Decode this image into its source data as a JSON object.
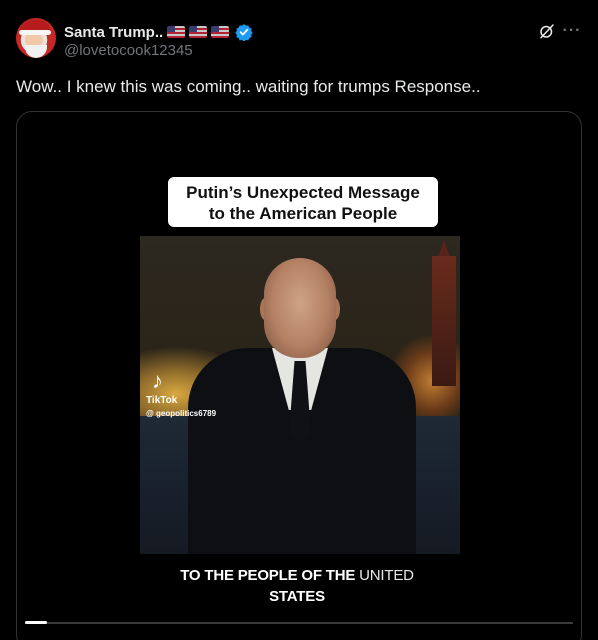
{
  "tweet": {
    "display_name": "Santa Trump..",
    "flags": [
      "us-flag",
      "us-flag",
      "us-flag"
    ],
    "handle": "@lovetocook12345",
    "verified": true,
    "text": "Wow.. I knew this was coming.. waiting for trumps Response.."
  },
  "media": {
    "caption_line1": "Putin’s Unexpected Message",
    "caption_line2": "to the American People",
    "watermark_brand": "TikTok",
    "watermark_user": "@ geopolitics6789",
    "subtitle_main": "TO THE PEOPLE OF THE ",
    "subtitle_highlight": "UNITED",
    "subtitle_line2": "STATES",
    "progress_fraction": 0.04
  },
  "icons": {
    "grok": "grok-icon",
    "more": "more-icon",
    "verified": "verified-icon"
  },
  "colors": {
    "background": "#000000",
    "text_primary": "#e7e9ea",
    "text_secondary": "#71767b",
    "verified": "#1d9bf0",
    "border": "#2f3336"
  }
}
